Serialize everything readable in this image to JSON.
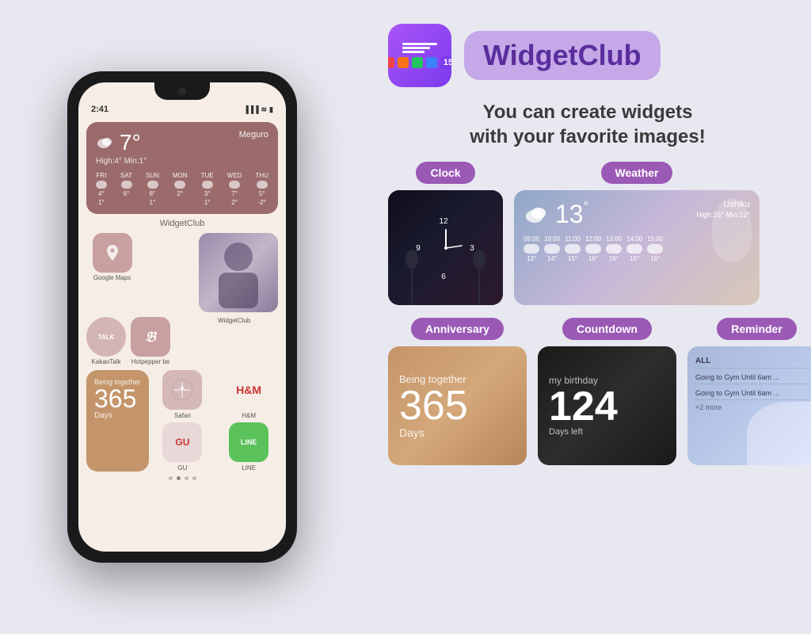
{
  "phone": {
    "time": "2:41",
    "signal_icons": "▐▐▐ ≋ ▮",
    "weather": {
      "temp": "7°",
      "location": "Meguro",
      "desc": "High:4° Min:1°",
      "days": [
        "FRI",
        "SAT",
        "SUN",
        "MON",
        "TUE",
        "WED",
        "THU"
      ],
      "temps": [
        [
          "4°",
          "1°"
        ],
        [
          "6°",
          ""
        ],
        [
          "8°",
          "1°"
        ],
        [
          "2°",
          ""
        ],
        [
          "3°",
          "1°"
        ],
        [
          "7°",
          "2°"
        ],
        [
          "5°",
          "-2°"
        ]
      ]
    },
    "widgetclub_label": "WidgetClub",
    "apps": [
      {
        "name": "Google Maps",
        "icon": "📍"
      },
      {
        "name": "KakaoTalk",
        "icon": "💬"
      },
      {
        "name": "Hotpepper be",
        "icon": "𝔅"
      },
      {
        "name": "WidgetClub",
        "icon": "📱"
      }
    ],
    "anniversary": {
      "being": "Being together",
      "number": "365",
      "label": "Days"
    },
    "small_apps": [
      {
        "name": "Safari",
        "icon": "⊙"
      },
      {
        "name": "H&M",
        "icon": "H&M"
      },
      {
        "name": "GU",
        "icon": "GU"
      },
      {
        "name": "LINE",
        "icon": "LINE"
      }
    ]
  },
  "right": {
    "app_name": "WidgetClub",
    "tagline_line1": "You can create widgets",
    "tagline_line2": "with your favorite images!",
    "widgets": [
      {
        "badge": "Clock",
        "type": "clock"
      },
      {
        "badge": "Weather",
        "weather": {
          "temp": "13°",
          "location": "Ushiku",
          "desc": "High:16° Min:12°",
          "hours": [
            "09:00",
            "10:00",
            "11:00",
            "12:00",
            "13:00",
            "14:00",
            "15:00"
          ],
          "hour_temps": [
            "13°",
            "14°",
            "15°",
            "16°",
            "16°",
            "16°",
            "16°"
          ]
        }
      }
    ],
    "bottom_widgets": [
      {
        "badge": "Anniversary",
        "being": "Being together",
        "number": "365",
        "label": "Days"
      },
      {
        "badge": "Countdown",
        "title": "my birthday",
        "number": "124",
        "label": "Days left"
      },
      {
        "badge": "Reminder",
        "items": [
          "ALL",
          "Going to Gym Until 6am ...",
          "Going to Gym Until 6am ..."
        ],
        "more": "+2 more"
      }
    ]
  }
}
